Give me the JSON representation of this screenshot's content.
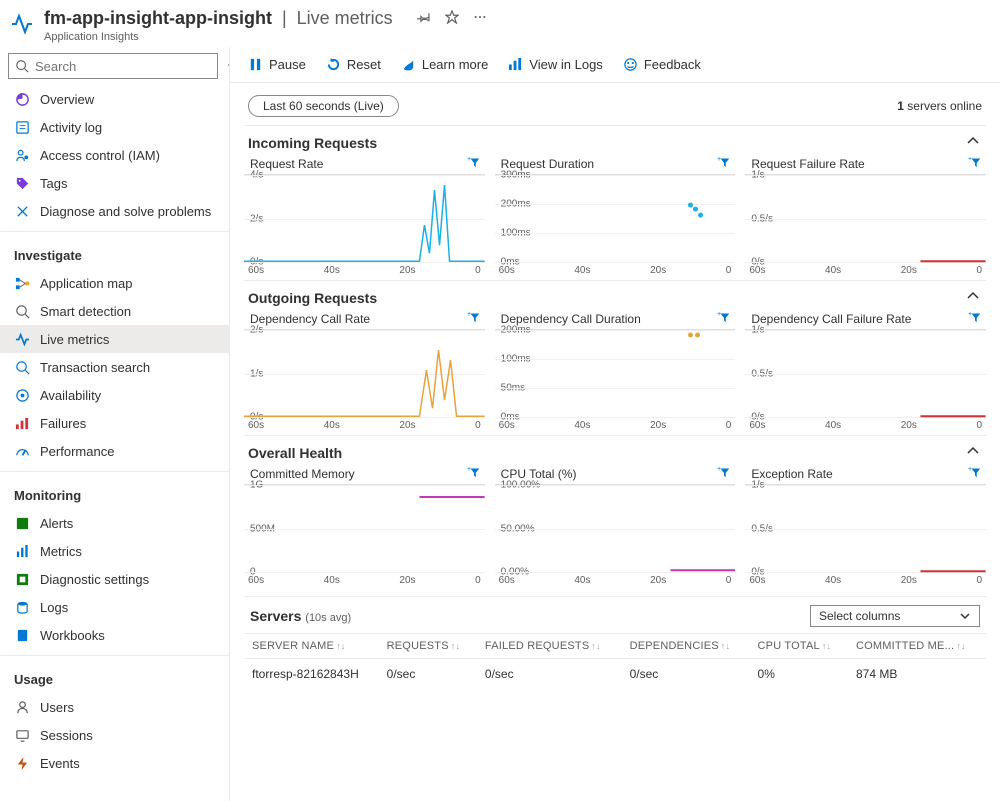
{
  "header": {
    "title_main": "fm-app-insight-app-insight",
    "title_sub": "Live metrics",
    "subtitle": "Application Insights"
  },
  "search": {
    "placeholder": "Search"
  },
  "nav": {
    "top": [
      {
        "icon": "overview",
        "color": "#773adc",
        "label": "Overview"
      },
      {
        "icon": "activity",
        "color": "#0078d4",
        "label": "Activity log"
      },
      {
        "icon": "iam",
        "color": "#0078d4",
        "label": "Access control (IAM)"
      },
      {
        "icon": "tags",
        "color": "#773adc",
        "label": "Tags"
      },
      {
        "icon": "diagnose",
        "color": "#0078d4",
        "label": "Diagnose and solve problems"
      }
    ],
    "investigate_label": "Investigate",
    "investigate": [
      {
        "icon": "appmap",
        "color": "#0078d4",
        "label": "Application map"
      },
      {
        "icon": "smart",
        "color": "#605e5c",
        "label": "Smart detection"
      },
      {
        "icon": "live",
        "color": "#0078d4",
        "label": "Live metrics",
        "active": true
      },
      {
        "icon": "search",
        "color": "#0078d4",
        "label": "Transaction search"
      },
      {
        "icon": "avail",
        "color": "#0078d4",
        "label": "Availability"
      },
      {
        "icon": "failures",
        "color": "#d13438",
        "label": "Failures"
      },
      {
        "icon": "perf",
        "color": "#0078d4",
        "label": "Performance"
      }
    ],
    "monitoring_label": "Monitoring",
    "monitoring": [
      {
        "icon": "alerts",
        "color": "#107c10",
        "label": "Alerts"
      },
      {
        "icon": "metrics",
        "color": "#0078d4",
        "label": "Metrics"
      },
      {
        "icon": "diag",
        "color": "#107c10",
        "label": "Diagnostic settings"
      },
      {
        "icon": "logs",
        "color": "#0078d4",
        "label": "Logs"
      },
      {
        "icon": "workbooks",
        "color": "#0078d4",
        "label": "Workbooks"
      }
    ],
    "usage_label": "Usage",
    "usage": [
      {
        "icon": "users",
        "color": "#605e5c",
        "label": "Users"
      },
      {
        "icon": "sessions",
        "color": "#605e5c",
        "label": "Sessions"
      },
      {
        "icon": "events",
        "color": "#ca5010",
        "label": "Events"
      }
    ]
  },
  "toolbar": {
    "pause": "Pause",
    "reset": "Reset",
    "learn": "Learn more",
    "logs": "View in Logs",
    "feedback": "Feedback"
  },
  "time_pill": "Last 60 seconds (Live)",
  "servers_online_count": "1",
  "servers_online_label": " servers online",
  "sections": {
    "incoming": "Incoming Requests",
    "outgoing": "Outgoing Requests",
    "health": "Overall Health"
  },
  "charts": {
    "incoming": [
      {
        "title": "Request Rate",
        "ylabels": [
          "4/s",
          "2/s",
          "0/s"
        ],
        "color": "#1cb0e6"
      },
      {
        "title": "Request Duration",
        "ylabels": [
          "300ms",
          "200ms",
          "100ms",
          "0ms"
        ],
        "color": "#1cb0e6"
      },
      {
        "title": "Request Failure Rate",
        "ylabels": [
          "1/s",
          "0.5/s",
          "0/s"
        ],
        "color": "#d13438"
      }
    ],
    "outgoing": [
      {
        "title": "Dependency Call Rate",
        "ylabels": [
          "2/s",
          "1/s",
          "0/s"
        ],
        "color": "#e8a33d"
      },
      {
        "title": "Dependency Call Duration",
        "ylabels": [
          "200ms",
          "100ms",
          "50ms",
          "0ms"
        ],
        "color": "#e8a33d"
      },
      {
        "title": "Dependency Call Failure Rate",
        "ylabels": [
          "1/s",
          "0.5/s",
          "0/s"
        ],
        "color": "#d13438"
      }
    ],
    "health": [
      {
        "title": "Committed Memory",
        "ylabels": [
          "1G",
          "500M",
          "0"
        ],
        "color": "#c239b3"
      },
      {
        "title": "CPU Total (%)",
        "ylabels": [
          "100.00%",
          "50.00%",
          "0.00%"
        ],
        "color": "#c239b3"
      },
      {
        "title": "Exception Rate",
        "ylabels": [
          "1/s",
          "0.5/s",
          "0/s"
        ],
        "color": "#d13438"
      }
    ],
    "xaxis": [
      "60s",
      "40s",
      "20s",
      "0"
    ]
  },
  "servers": {
    "title": "Servers",
    "avg": "(10s avg)",
    "select_cols": "Select columns",
    "columns": [
      "SERVER NAME",
      "REQUESTS",
      "FAILED REQUESTS",
      "DEPENDENCIES",
      "CPU TOTAL",
      "COMMITTED ME..."
    ],
    "rows": [
      {
        "name": "ftorresp-82162843H",
        "requests": "0/sec",
        "failed": "0/sec",
        "deps": "0/sec",
        "cpu": "0%",
        "mem": "874 MB"
      }
    ]
  },
  "chart_data": [
    {
      "type": "line",
      "title": "Request Rate",
      "x": [
        60,
        40,
        20,
        0
      ],
      "ylim": [
        0,
        4
      ],
      "ylabel": "/s",
      "series": [
        {
          "name": "rate",
          "values_approx": "spike ~3.5/s near 12s, 0 elsewhere"
        }
      ]
    },
    {
      "type": "scatter",
      "title": "Request Duration",
      "x": [
        60,
        40,
        20,
        0
      ],
      "ylim": [
        0,
        300
      ],
      "ylabel": "ms",
      "points_approx": [
        {
          "x": 12,
          "y": 200
        },
        {
          "x": 10,
          "y": 190
        },
        {
          "x": 8,
          "y": 175
        }
      ]
    },
    {
      "type": "line",
      "title": "Request Failure Rate",
      "x": [
        60,
        40,
        20,
        0
      ],
      "ylim": [
        0,
        1
      ],
      "ylabel": "/s",
      "values": "flat 0"
    },
    {
      "type": "line",
      "title": "Dependency Call Rate",
      "x": [
        60,
        40,
        20,
        0
      ],
      "ylim": [
        0,
        2
      ],
      "ylabel": "/s",
      "series": [
        {
          "name": "rate",
          "values_approx": "spike ~1.6/s near 12s, 0 elsewhere"
        }
      ]
    },
    {
      "type": "scatter",
      "title": "Dependency Call Duration",
      "x": [
        60,
        40,
        20,
        0
      ],
      "ylim": [
        0,
        200
      ],
      "ylabel": "ms",
      "points_approx": [
        {
          "x": 12,
          "y": 195
        },
        {
          "x": 10,
          "y": 195
        }
      ]
    },
    {
      "type": "line",
      "title": "Dependency Call Failure Rate",
      "x": [
        60,
        40,
        20,
        0
      ],
      "ylim": [
        0,
        1
      ],
      "ylabel": "/s",
      "values": "flat 0"
    },
    {
      "type": "line",
      "title": "Committed Memory",
      "x": [
        60,
        40,
        20,
        0
      ],
      "ylim": [
        0,
        1000000000
      ],
      "ylabel": "bytes",
      "values_approx": "flat ~870M starting ~15s"
    },
    {
      "type": "line",
      "title": "CPU Total (%)",
      "x": [
        60,
        40,
        20,
        0
      ],
      "ylim": [
        0,
        100
      ],
      "ylabel": "%",
      "values_approx": "flat ~1% starting ~15s"
    },
    {
      "type": "line",
      "title": "Exception Rate",
      "x": [
        60,
        40,
        20,
        0
      ],
      "ylim": [
        0,
        1
      ],
      "ylabel": "/s",
      "values": "flat 0"
    }
  ]
}
